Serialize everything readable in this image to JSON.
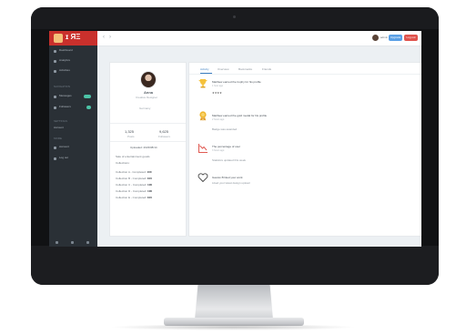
{
  "sidebar": {
    "logo_text": "ɪ ЯΞ",
    "items": [
      {
        "label": "Dashboard"
      },
      {
        "label": "Analytics"
      },
      {
        "label": "Activities"
      },
      {
        "label": "Messages"
      },
      {
        "label": "Followers"
      }
    ],
    "section_one": "NAVIGATION",
    "section_two": "SETTINGS",
    "section_three": "MORE",
    "extra_items": [
      {
        "label": "Account"
      },
      {
        "label": "Log out"
      }
    ]
  },
  "topbar": {
    "back": "‹",
    "forward": "›",
    "user": "admin",
    "blue_btn": "Upgrade",
    "red_btn": "Log out"
  },
  "profile": {
    "name": "Anna",
    "role": "Creative Designer",
    "location": "Germany",
    "stat1_value": "1,325",
    "stat1_label": "Posts",
    "stat2_value": "9,625",
    "stat2_label": "Followers",
    "heading": "Uploaded: 2023/08/14",
    "line1": "Sale of entertainment goods",
    "line2": "Collections:",
    "rows": [
      {
        "k": "Collection A - Completed:",
        "v": "100"
      },
      {
        "k": "Collection B - Completed:",
        "v": "100"
      },
      {
        "k": "Collection C - Completed:",
        "v": "100"
      },
      {
        "k": "Collection D - Completed:",
        "v": "100"
      },
      {
        "k": "Collection E - Completed:",
        "v": "100"
      }
    ]
  },
  "tabs": [
    "Activity",
    "Overview",
    "Bookmarks",
    "Friends"
  ],
  "feed": [
    {
      "title": "Matthew earned the trophy for his profile",
      "sub": "1 hour ago",
      "extra": "★★★★"
    },
    {
      "title": "Matthew earned the gold medal for his profile",
      "sub": "2 hours ago",
      "extra": "Badge was awarded"
    },
    {
      "title": "The percentage of user",
      "sub": "3 hours ago",
      "extra": "Statistics updated this week"
    },
    {
      "title": "Gaurav B liked your work",
      "sub": "",
      "extra": "Liked your latest design upload"
    }
  ],
  "colors": {
    "accent": "#3d7fc1",
    "sidebar": "#2a3036",
    "logo": "#c9302c"
  }
}
